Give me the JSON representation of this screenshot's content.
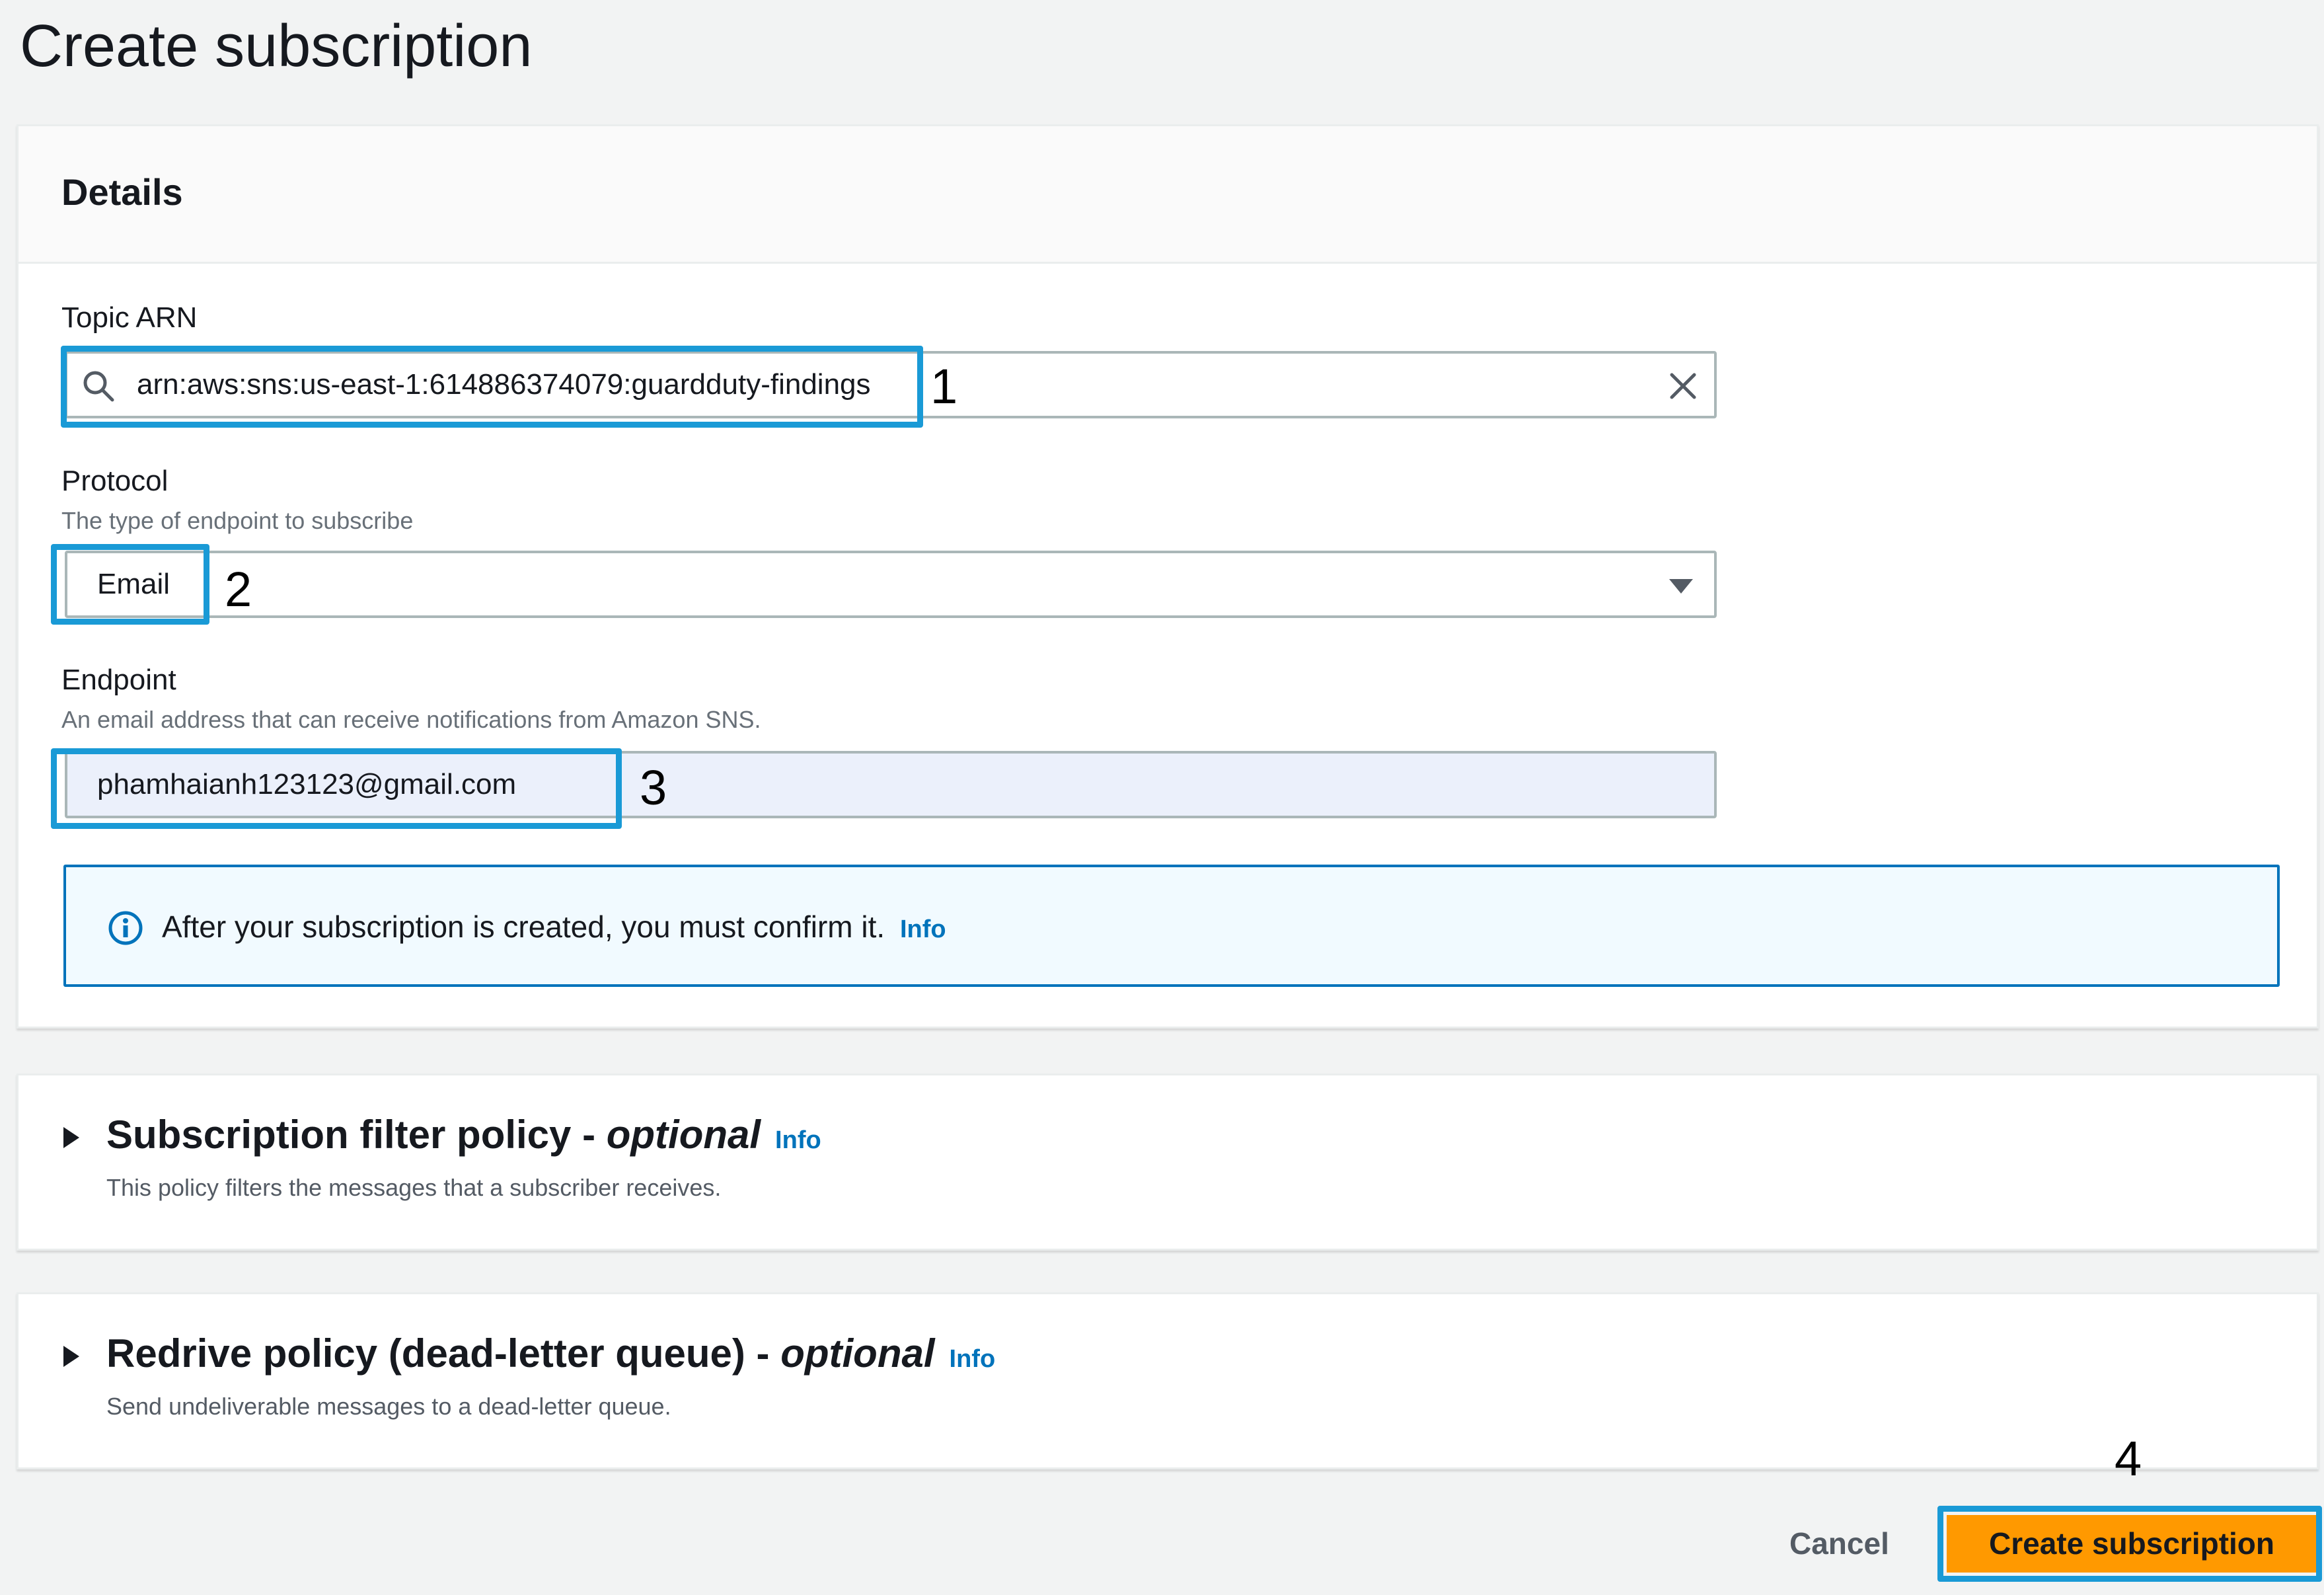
{
  "page": {
    "title": "Create subscription"
  },
  "details": {
    "header": "Details",
    "topic_arn": {
      "label": "Topic ARN",
      "value": "arn:aws:sns:us-east-1:614886374079:guardduty-findings"
    },
    "protocol": {
      "label": "Protocol",
      "description": "The type of endpoint to subscribe",
      "value": "Email"
    },
    "endpoint": {
      "label": "Endpoint",
      "description": "An email address that can receive notifications from Amazon SNS.",
      "value": "phamhaianh123123@gmail.com"
    },
    "alert": {
      "text": "After your subscription is created, you must confirm it.",
      "link": "Info"
    }
  },
  "filter_policy": {
    "title": "Subscription filter policy - ",
    "optional": "optional",
    "info": "Info",
    "description": "This policy filters the messages that a subscriber receives."
  },
  "redrive_policy": {
    "title": "Redrive policy (dead-letter queue) - ",
    "optional": "optional",
    "info": "Info",
    "description": "Send undeliverable messages to a dead-letter queue."
  },
  "footer": {
    "cancel": "Cancel",
    "create": "Create subscription"
  },
  "annotations": {
    "a1": "1",
    "a2": "2",
    "a3": "3",
    "a4": "4"
  },
  "colors": {
    "highlight": "#1a9ad6",
    "primary_button": "#ff9900",
    "link": "#0073bb",
    "endpoint_fill": "#ebf0fb"
  }
}
